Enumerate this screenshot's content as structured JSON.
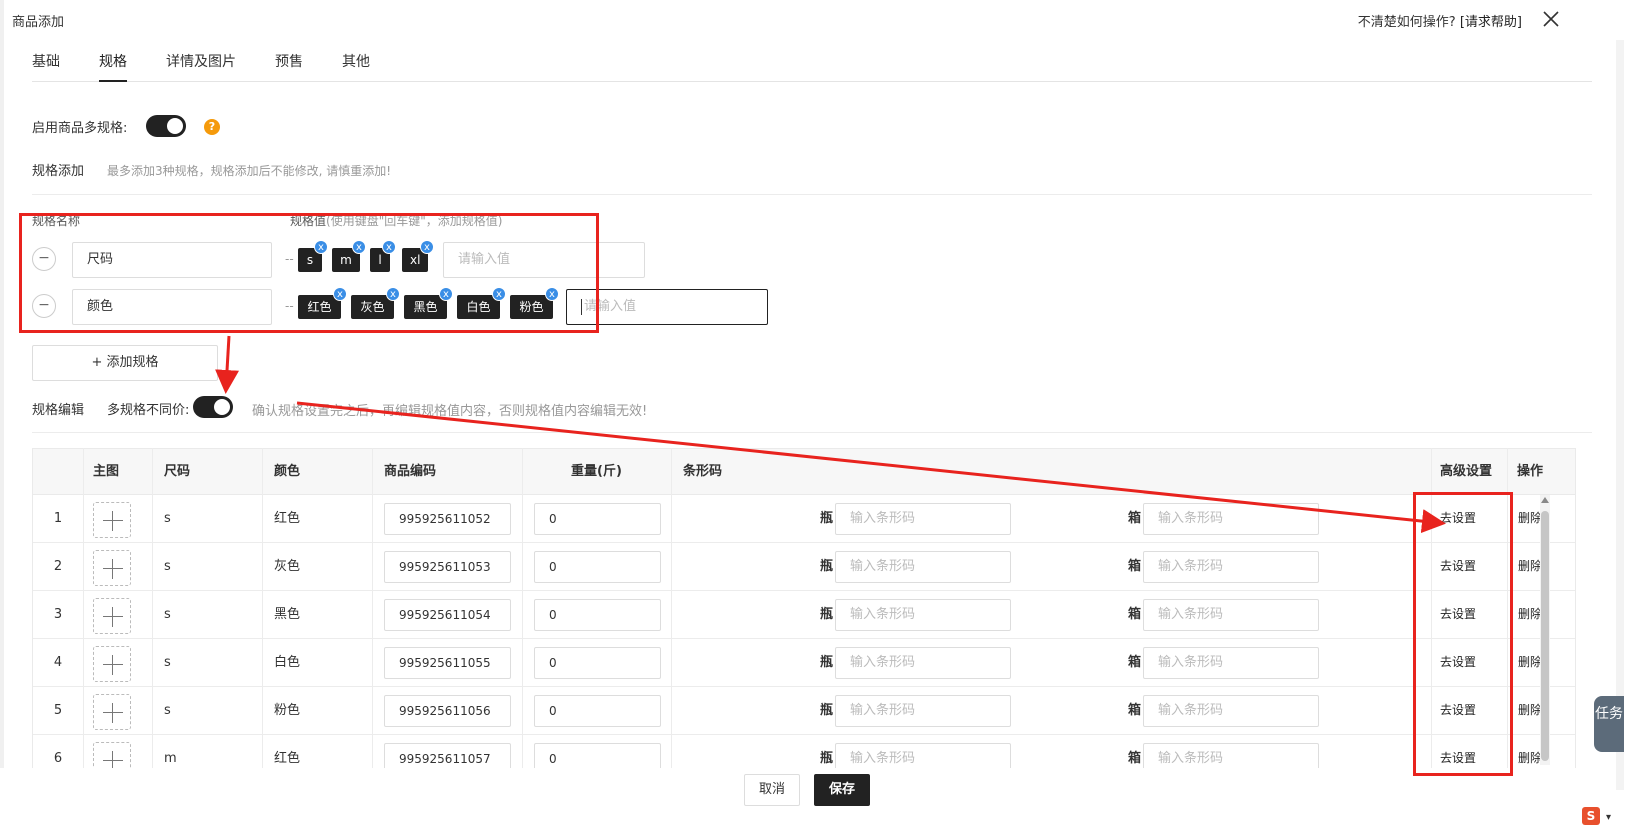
{
  "header": {
    "title": "商品添加",
    "help_text": "不清楚如何操作?",
    "help_link": "[请求帮助]"
  },
  "tabs": [
    {
      "label": "基础",
      "active": false
    },
    {
      "label": "规格",
      "active": true
    },
    {
      "label": "详情及图片",
      "active": false
    },
    {
      "label": "预售",
      "active": false
    },
    {
      "label": "其他",
      "active": false
    }
  ],
  "multi_spec": {
    "label": "启用商品多规格:",
    "enabled": true,
    "help_icon": "?"
  },
  "spec_add": {
    "label": "规格添加",
    "hint": "最多添加3种规格，规格添加后不能修改, 请慎重添加!"
  },
  "spec_table": {
    "name_header": "规格名称",
    "value_header": "规格值",
    "value_header_hint": "(使用键盘\"回车键\"，添加规格值)",
    "rows": [
      {
        "minus": "−",
        "name": "尺码",
        "dash": "--",
        "values": [
          "s",
          "m",
          "l",
          "xl"
        ],
        "input_placeholder": "请输入值"
      },
      {
        "minus": "−",
        "name": "颜色",
        "dash": "--",
        "values": [
          "红色",
          "灰色",
          "黑色",
          "白色",
          "粉色"
        ],
        "input_placeholder": "请输入值"
      }
    ],
    "chip_remove": "x",
    "add_button": "+ 添加规格"
  },
  "spec_edit": {
    "label": "规格编辑",
    "diff_price_label": "多规格不同价:",
    "diff_price_enabled": true,
    "hint": "确认规格设置完之后，再编辑规格值内容，否则规格值内容编辑无效!"
  },
  "sku_table": {
    "headers": [
      "主图",
      "尺码",
      "颜色",
      "商品编码",
      "重量(斤)",
      "条形码",
      "高级设置",
      "操作"
    ],
    "barcode_bottle_label": "瓶",
    "barcode_box_label": "箱",
    "barcode_placeholder": "输入条形码",
    "settings_link": "去设置",
    "delete_link": "删除",
    "rows": [
      {
        "index": "1",
        "size": "s",
        "color": "红色",
        "code": "995925611052",
        "weight": "0"
      },
      {
        "index": "2",
        "size": "s",
        "color": "灰色",
        "code": "995925611053",
        "weight": "0"
      },
      {
        "index": "3",
        "size": "s",
        "color": "黑色",
        "code": "995925611054",
        "weight": "0"
      },
      {
        "index": "4",
        "size": "s",
        "color": "白色",
        "code": "995925611055",
        "weight": "0"
      },
      {
        "index": "5",
        "size": "s",
        "color": "粉色",
        "code": "995925611056",
        "weight": "0"
      },
      {
        "index": "6",
        "size": "m",
        "color": "红色",
        "code": "995925611057",
        "weight": "0"
      }
    ]
  },
  "footer": {
    "cancel": "取消",
    "save": "保存"
  },
  "task_tab": "任务",
  "ime_icon": "S",
  "ime_dropdown": "▾",
  "colors": {
    "accent_dark": "#222222",
    "annotation_red": "#e8231e",
    "chip_close_blue": "#3a8ee6",
    "help_orange": "#f59a0b"
  }
}
